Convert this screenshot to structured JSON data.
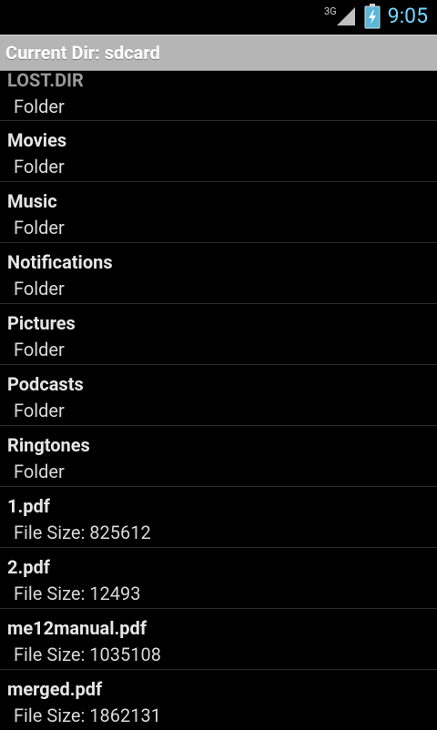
{
  "status": {
    "network": "3G",
    "time": "9:05"
  },
  "header": {
    "title": "Current Dir: sdcard"
  },
  "items": [
    {
      "name": "LOST.DIR",
      "detail": "Folder"
    },
    {
      "name": "Movies",
      "detail": "Folder"
    },
    {
      "name": "Music",
      "detail": "Folder"
    },
    {
      "name": "Notifications",
      "detail": "Folder"
    },
    {
      "name": "Pictures",
      "detail": "Folder"
    },
    {
      "name": "Podcasts",
      "detail": "Folder"
    },
    {
      "name": "Ringtones",
      "detail": "Folder"
    },
    {
      "name": "1.pdf",
      "detail": "File Size: 825612"
    },
    {
      "name": "2.pdf",
      "detail": "File Size: 12493"
    },
    {
      "name": "me12manual.pdf",
      "detail": "File Size: 1035108"
    },
    {
      "name": "merged.pdf",
      "detail": "File Size: 1862131"
    }
  ]
}
